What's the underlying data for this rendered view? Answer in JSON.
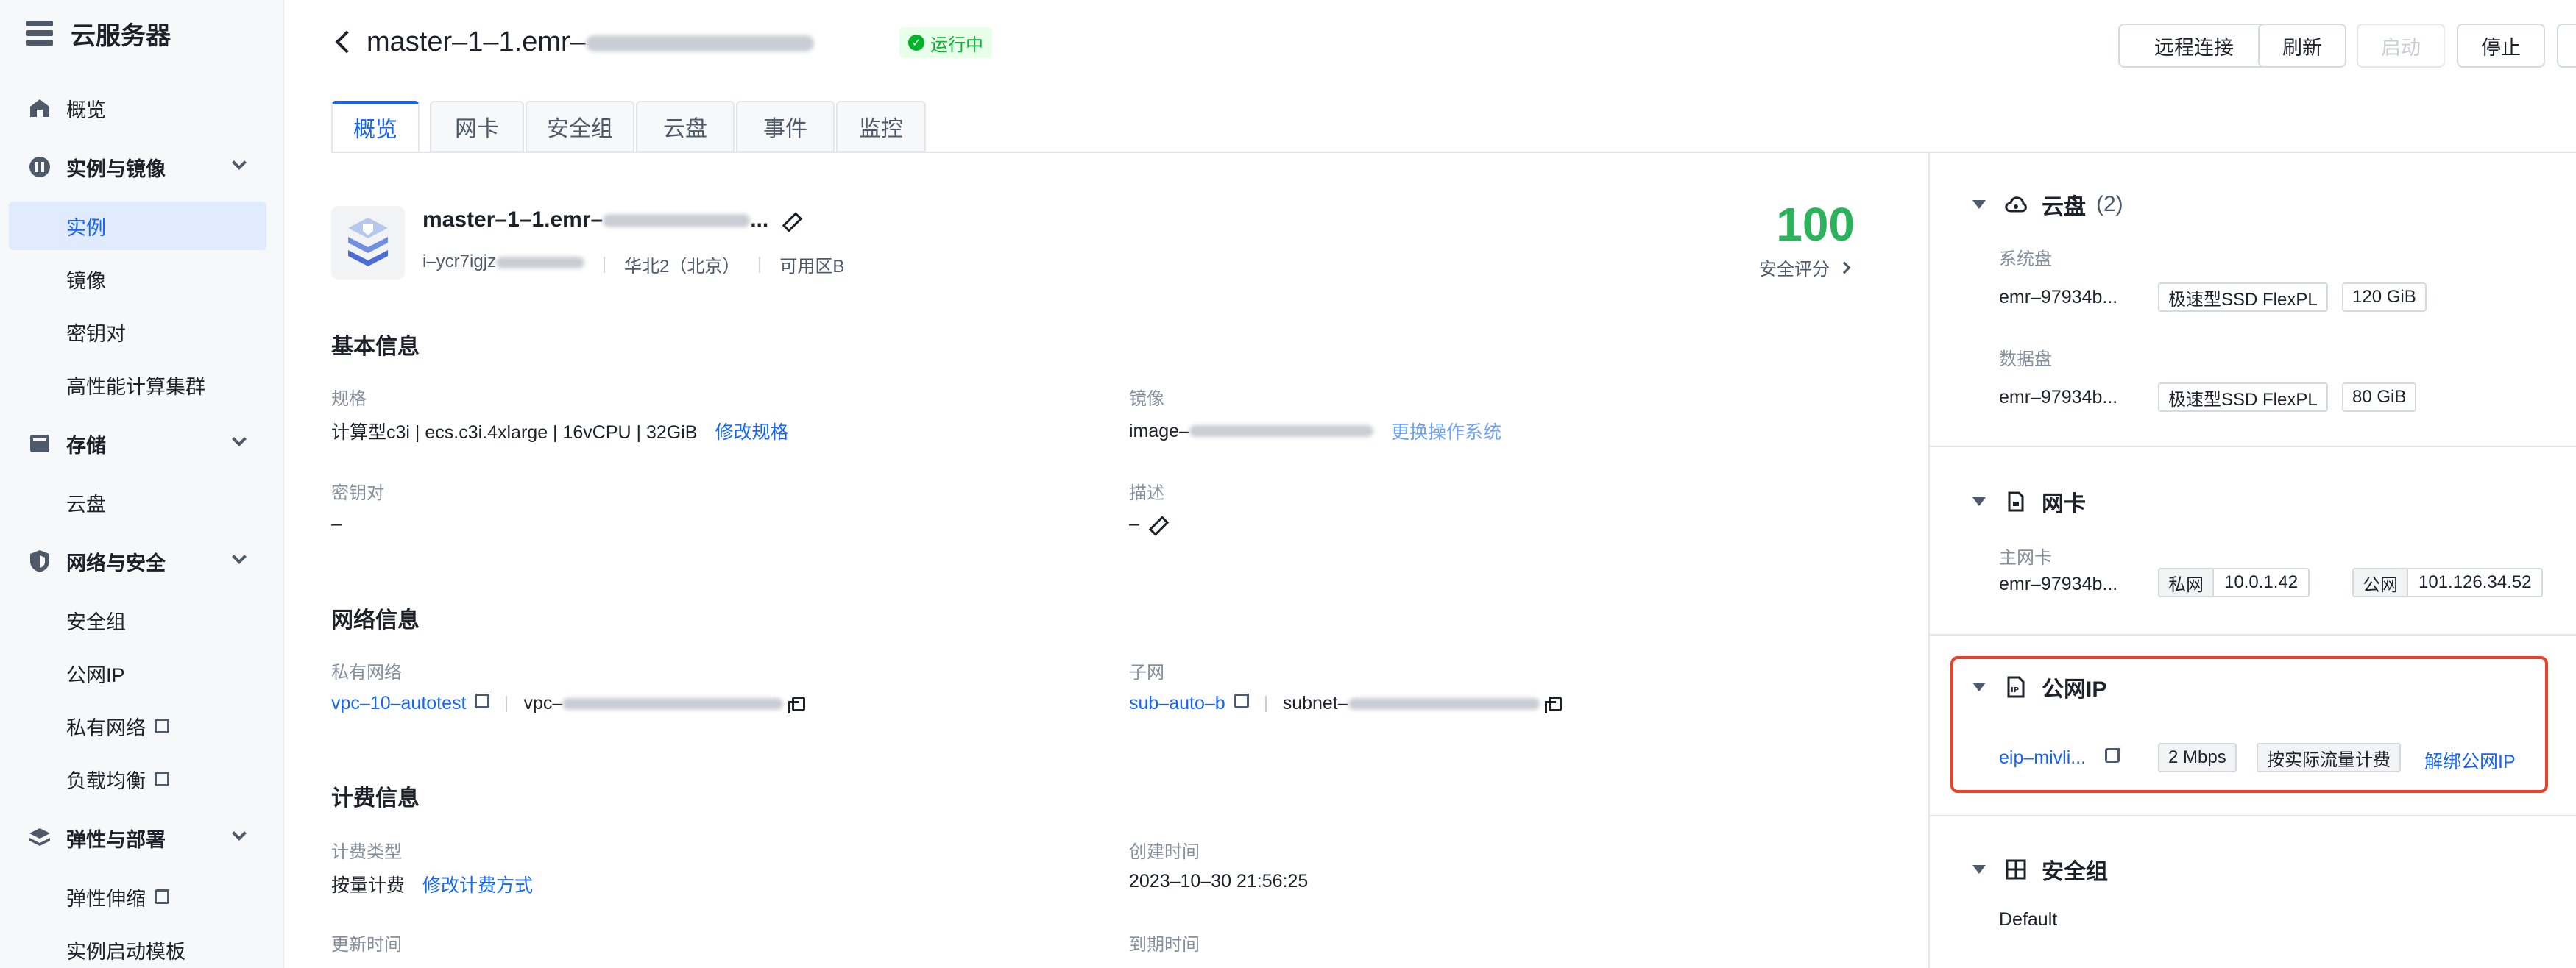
{
  "sidebar": {
    "title": "云服务器",
    "items": [
      {
        "label": "概览"
      },
      {
        "label": "实例与镜像"
      },
      {
        "label": "实例"
      },
      {
        "label": "镜像"
      },
      {
        "label": "密钥对"
      },
      {
        "label": "高性能计算集群"
      },
      {
        "label": "存储"
      },
      {
        "label": "云盘"
      },
      {
        "label": "网络与安全"
      },
      {
        "label": "安全组"
      },
      {
        "label": "公网IP"
      },
      {
        "label": "私有网络"
      },
      {
        "label": "负载均衡"
      },
      {
        "label": "弹性与部署"
      },
      {
        "label": "弹性伸缩"
      },
      {
        "label": "实例启动模板"
      }
    ]
  },
  "header": {
    "title_prefix": "master–1–1.emr–",
    "status": "运行中",
    "buttons": {
      "remote": "远程连接",
      "refresh": "刷新",
      "start": "启动",
      "stop": "停止"
    }
  },
  "tabs": [
    "概览",
    "网卡",
    "安全组",
    "云盘",
    "事件",
    "监控"
  ],
  "instance": {
    "name": "master–1–1.emr–",
    "name_suffix": "...",
    "id_prefix": "i–ycr7igjz",
    "region": "华北2（北京）",
    "zone": "可用区B",
    "score": "100",
    "score_label": "安全评分"
  },
  "basic": {
    "title": "基本信息",
    "spec_label": "规格",
    "spec_value": "计算型c3i | ecs.c3i.4xlarge | 16vCPU | 32GiB",
    "spec_link": "修改规格",
    "image_label": "镜像",
    "image_prefix": "image–",
    "image_link": "更换操作系统",
    "keypair_label": "密钥对",
    "keypair_value": "–",
    "desc_label": "描述",
    "desc_value": "–"
  },
  "network": {
    "title": "网络信息",
    "vpc_label": "私有网络",
    "vpc_link": "vpc–10–autotest",
    "vpc_id_prefix": "vpc–",
    "subnet_label": "子网",
    "subnet_link": "sub–auto–b",
    "subnet_id_prefix": "subnet–"
  },
  "billing": {
    "title": "计费信息",
    "type_label": "计费类型",
    "type_value": "按量计费",
    "type_link": "修改计费方式",
    "created_label": "创建时间",
    "created_value": "2023–10–30 21:56:25",
    "updated_label": "更新时间",
    "expire_label": "到期时间"
  },
  "right": {
    "disk": {
      "title": "云盘",
      "count": "(2)",
      "sys_label": "系统盘",
      "sys_name": "emr–97934b...",
      "sys_type": "极速型SSD FlexPL",
      "sys_size": "120 GiB",
      "data_label": "数据盘",
      "data_name": "emr–97934b...",
      "data_type": "极速型SSD FlexPL",
      "data_size": "80 GiB"
    },
    "nic": {
      "title": "网卡",
      "main_label": "主网卡",
      "name": "emr–97934b...",
      "private_key": "私网",
      "private_ip": "10.0.1.42",
      "public_key": "公网",
      "public_ip": "101.126.34.52"
    },
    "eip": {
      "title": "公网IP",
      "name": "eip–mivli...",
      "bandwidth": "2 Mbps",
      "billing": "按实际流量计费",
      "unbind": "解绑公网IP"
    },
    "sg": {
      "title": "安全组",
      "name": "Default"
    }
  },
  "colors": {
    "accent": "#1664ff",
    "success": "#00b42a",
    "score": "#2bb35c",
    "highlight": "#e8412c"
  }
}
